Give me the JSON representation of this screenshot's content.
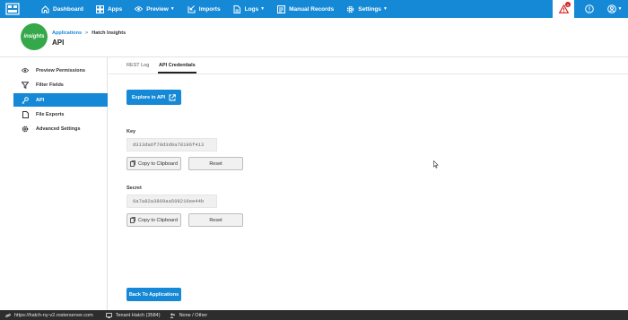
{
  "topnav": {
    "items": [
      {
        "label": "Dashboard",
        "icon": "home-icon"
      },
      {
        "label": "Apps",
        "icon": "grid-icon"
      },
      {
        "label": "Preview",
        "icon": "eye-icon",
        "dropdown": true
      },
      {
        "label": "Imports",
        "icon": "import-icon"
      },
      {
        "label": "Logs",
        "icon": "document-icon",
        "dropdown": true
      },
      {
        "label": "Manual Records",
        "icon": "list-icon"
      },
      {
        "label": "Settings",
        "icon": "gear-icon",
        "dropdown": true
      }
    ],
    "alert_count": "5",
    "accent": "#1689d6"
  },
  "header": {
    "logo_text": "insights",
    "breadcrumb_parent": "Applications",
    "breadcrumb_sep": ">",
    "breadcrumb_current": "Hatch Insights",
    "title": "API"
  },
  "sidebar": {
    "items": [
      {
        "label": "Preview Permissions",
        "icon": "eye-icon"
      },
      {
        "label": "Filter Fields",
        "icon": "filter-icon"
      },
      {
        "label": "API",
        "icon": "key-icon",
        "active": true
      },
      {
        "label": "File Exports",
        "icon": "file-icon"
      },
      {
        "label": "Advanced Settings",
        "icon": "gear-icon"
      }
    ]
  },
  "tabs": [
    {
      "label": "REST Log"
    },
    {
      "label": "API Credentials",
      "active": true
    }
  ],
  "main": {
    "explore_label": "Explore in API",
    "key_label": "Key",
    "key_value": "d313da6f78d3d0a78196f413",
    "secret_label": "Secret",
    "secret_value": "6a7a82a3869aa508216ee44b",
    "copy_label": "Copy to Clipboard",
    "reset_label": "Reset",
    "back_label": "Back To Applications"
  },
  "statusbar": {
    "url": "https://hatch-ny-v2.rosterserver.com",
    "tenant": "Tenant Hatch (3584)",
    "user": "None / Other"
  }
}
